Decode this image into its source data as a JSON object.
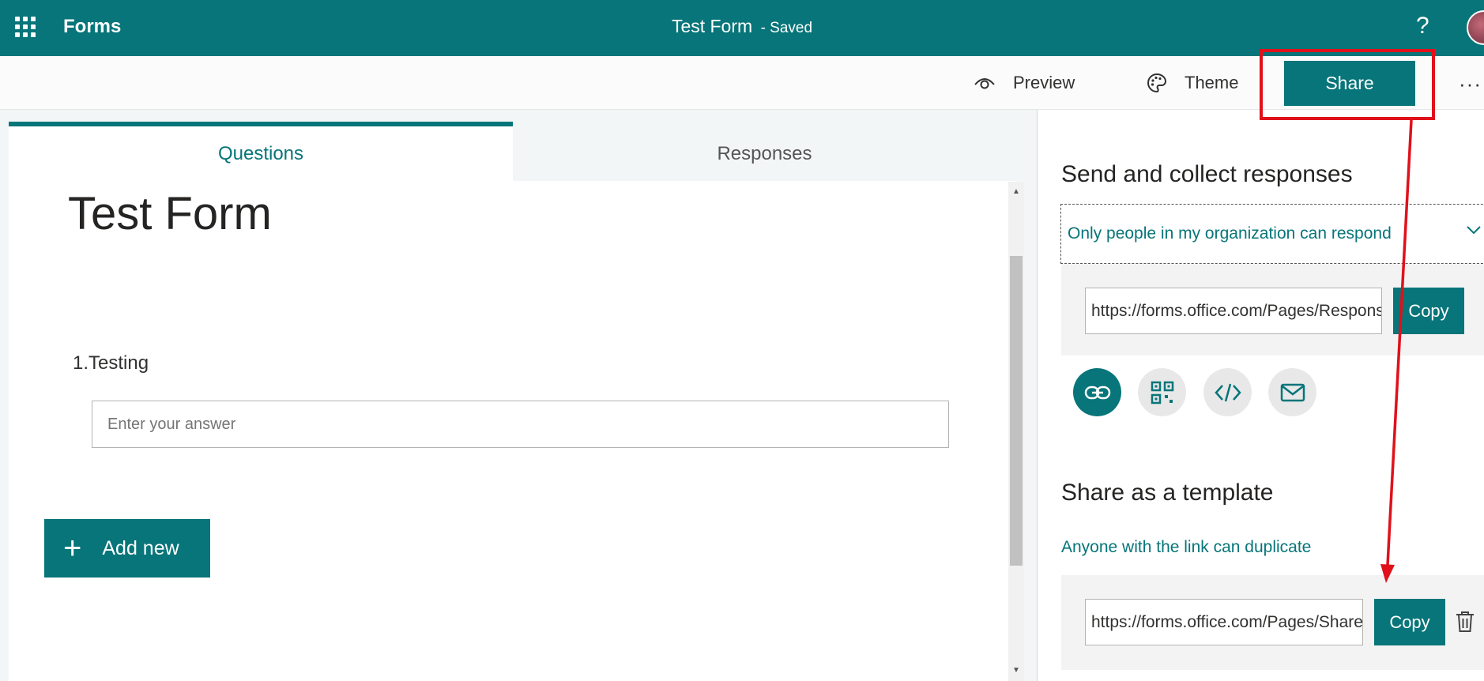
{
  "appbar": {
    "app_name": "Forms",
    "doc_title": "Test Form",
    "separator": "-",
    "save_status": "Saved",
    "help_label": "?"
  },
  "commands": {
    "preview_label": "Preview",
    "theme_label": "Theme",
    "share_label": "Share",
    "more_label": "···"
  },
  "tabs": [
    {
      "label": "Questions",
      "active": true
    },
    {
      "label": "Responses",
      "active": false
    }
  ],
  "form": {
    "title": "Test Form",
    "question_number": "1.",
    "question_text": "Testing",
    "answer_placeholder": "Enter your answer",
    "add_new_label": "Add new",
    "add_new_icon": "+"
  },
  "share_panel": {
    "send_heading": "Send and collect responses",
    "permission": "Only people in my organization can respond",
    "response_url": "https://forms.office.com/Pages/ResponsePage.aspx",
    "copy_label": "Copy",
    "modes": [
      "link-icon",
      "qr-code-icon",
      "embed-code-icon",
      "email-icon"
    ],
    "active_mode": "link-icon",
    "template_heading": "Share as a template",
    "template_permission": "Anyone with the link can duplicate",
    "template_url": "https://forms.office.com/Pages/ShareFormPage.aspx",
    "template_copy_label": "Copy"
  },
  "colors": {
    "brand": "#077579",
    "annotation": "#e0111b"
  }
}
